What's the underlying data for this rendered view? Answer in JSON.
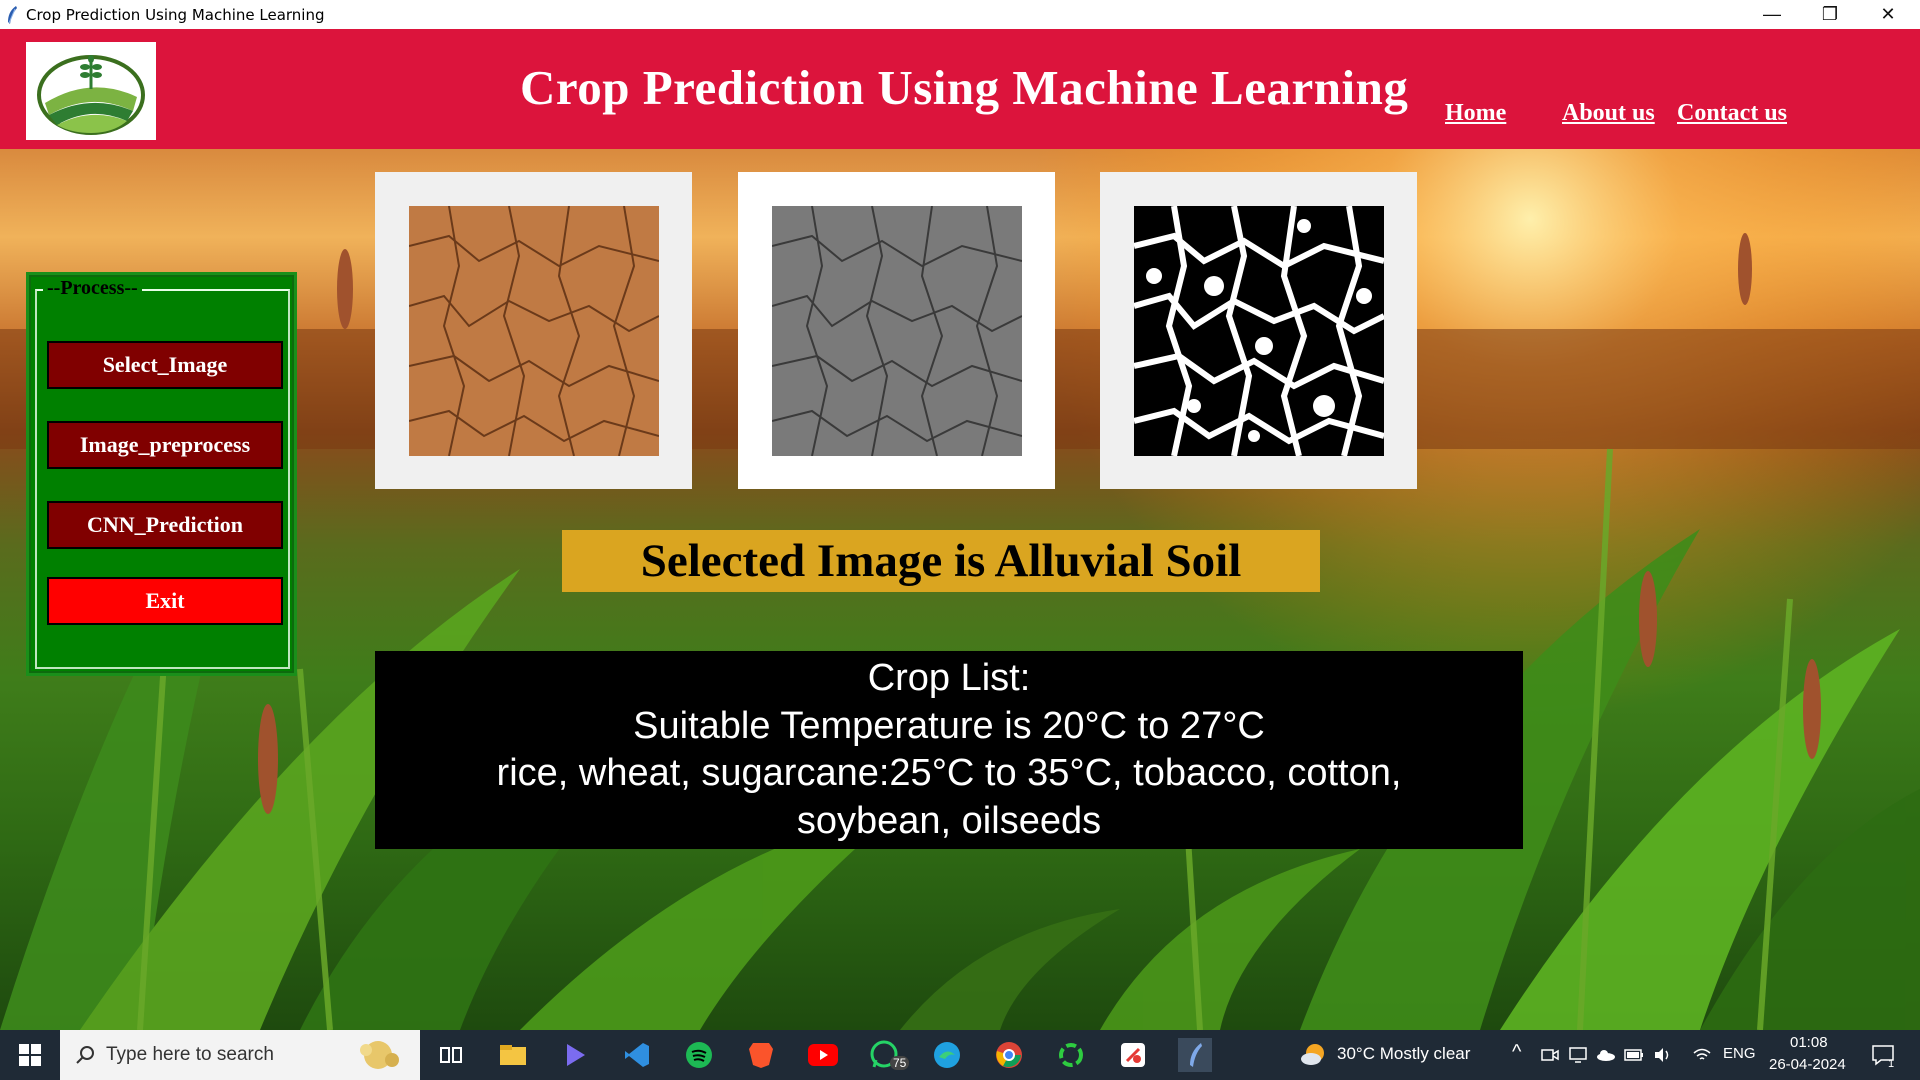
{
  "window": {
    "title": "Crop Prediction Using Machine Learning",
    "controls": {
      "minimize": "—",
      "restore": "❐",
      "close": "✕"
    }
  },
  "header": {
    "heading": "Crop Prediction Using Machine Learning",
    "nav": {
      "home": "Home",
      "about": "About us",
      "contact": "Contact us"
    }
  },
  "process": {
    "legend": "--Process--",
    "buttons": {
      "select_image": "Select_Image",
      "preprocess": "Image_preprocess",
      "cnn_prediction": "CNN_Prediction",
      "exit": "Exit"
    }
  },
  "result": {
    "banner": "Selected Image is Alluvial Soil",
    "crop_list_lines": [
      "Crop List:",
      "Suitable Temperature is 20°C to 27°C",
      "rice, wheat, sugarcane:25°C to 35°C, tobacco, cotton,",
      "soybean, oilseeds"
    ]
  },
  "taskbar": {
    "search_placeholder": "Type here to search",
    "weather": "30°C  Mostly clear",
    "language": "ENG",
    "time": "01:08",
    "date": "26-04-2024",
    "whatsapp_badge": "75",
    "notification_count": "1"
  },
  "colors": {
    "header_red": "#dc143c",
    "panel_green": "#008000",
    "button_maroon": "#800000",
    "exit_red": "#ff0000",
    "banner_gold": "#daa520"
  }
}
